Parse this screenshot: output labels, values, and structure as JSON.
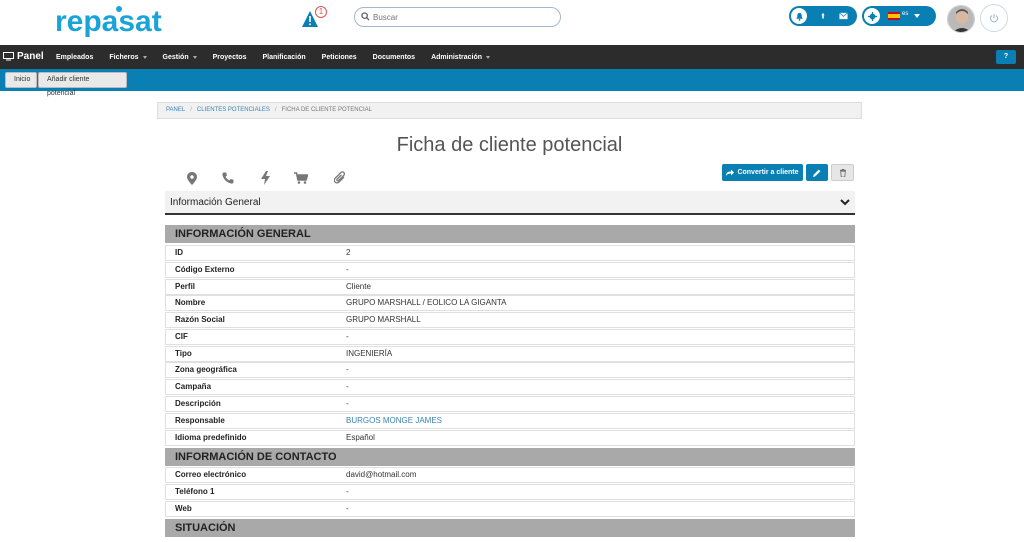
{
  "app": {
    "logo_text": "repasat",
    "alert_count": "1",
    "search_placeholder": "Buscar",
    "language_code": "es"
  },
  "nav": {
    "brand": "Panel",
    "items": [
      {
        "label": "Empleados",
        "dropdown": false
      },
      {
        "label": "Ficheros",
        "dropdown": true
      },
      {
        "label": "Gestión",
        "dropdown": true
      },
      {
        "label": "Proyectos",
        "dropdown": false
      },
      {
        "label": "Planificación",
        "dropdown": false
      },
      {
        "label": "Peticiones",
        "dropdown": false
      },
      {
        "label": "Documentos",
        "dropdown": false
      },
      {
        "label": "Administración",
        "dropdown": true
      }
    ],
    "help": "?"
  },
  "tabs": {
    "home": "Inicio",
    "add": "Añadir cliente potencial"
  },
  "breadcrumb": {
    "panel": "PANEL",
    "clients": "CLIENTES POTENCIALES",
    "current": "FICHA DE CLIENTE POTENCIAL"
  },
  "page": {
    "title": "Ficha de cliente potencial",
    "convert_label": "Convertir a cliente",
    "panel_title": "Información General"
  },
  "sections": {
    "general": "INFORMACIÓN GENERAL",
    "contact": "INFORMACIÓN DE CONTACTO",
    "situation": "SITUACIÓN"
  },
  "general_rows": [
    {
      "label": "ID",
      "value": "2"
    },
    {
      "label": "Código Externo",
      "value": "-"
    },
    {
      "label": "Perfil",
      "value": "Cliente"
    },
    {
      "label": "Nombre",
      "value": "GRUPO MARSHALL / EOLICO LA GIGANTA"
    },
    {
      "label": "Razón Social",
      "value": "GRUPO MARSHALL"
    },
    {
      "label": "CIF",
      "value": "-"
    },
    {
      "label": "Tipo",
      "value": "INGENIERÍA"
    },
    {
      "label": "Zona geográfica",
      "value": "-"
    },
    {
      "label": "Campaña",
      "value": "-"
    },
    {
      "label": "Descripción",
      "value": "-"
    },
    {
      "label": "Responsable",
      "value": "BURGOS MONGE JAMES"
    },
    {
      "label": "Idioma predefinido",
      "value": "Español"
    }
  ],
  "contact_rows": [
    {
      "label": "Correo electrónico",
      "value": "david@hotmail.com"
    },
    {
      "label": "Teléfono 1",
      "value": "-"
    },
    {
      "label": "Web",
      "value": "-"
    }
  ],
  "colors": {
    "brand_blue": "#0a7fb3",
    "navbar": "#2c2c2c",
    "section_gray": "#a9a9a9"
  }
}
